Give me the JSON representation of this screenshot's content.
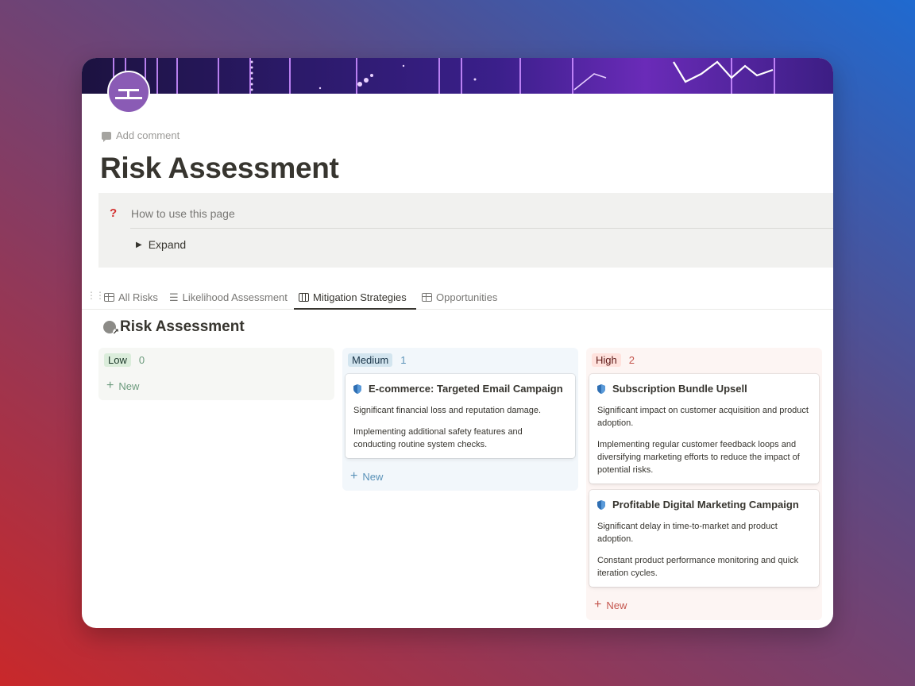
{
  "page": {
    "add_comment": "Add comment",
    "title": "Risk Assessment"
  },
  "callout": {
    "icon": "?",
    "title": "How to use this page",
    "toggle_label": "Expand"
  },
  "tabs": [
    {
      "label": "All Risks",
      "icon": "table-icon"
    },
    {
      "label": "Likelihood Assessment",
      "icon": "list-icon"
    },
    {
      "label": "Mitigation Strategies",
      "icon": "board-icon",
      "active": true
    },
    {
      "label": "Opportunities",
      "icon": "table-icon"
    }
  ],
  "database": {
    "title": "Risk Assessment"
  },
  "board": {
    "new_label": "New",
    "columns": [
      {
        "label": "Low",
        "count": "0",
        "color": "#dbeddb",
        "cards": []
      },
      {
        "label": "Medium",
        "count": "1",
        "color": "#d3e5ef",
        "cards": [
          {
            "title": "E-commerce: Targeted Email Campaign",
            "impact": "Significant financial loss and reputation damage.",
            "mitigation": "Implementing additional safety features and conducting routine system checks."
          }
        ]
      },
      {
        "label": "High",
        "count": "2",
        "color": "#ffe2dd",
        "cards": [
          {
            "title": "Subscription Bundle Upsell",
            "impact": "Significant impact on customer acquisition and product adoption.",
            "mitigation": "Implementing regular customer feedback loops and diversifying marketing efforts to reduce the impact of potential risks."
          },
          {
            "title": "Profitable Digital Marketing Campaign",
            "impact": "Significant delay in time-to-market and product adoption.",
            "mitigation": "Constant product performance monitoring and quick iteration cycles."
          }
        ]
      }
    ]
  }
}
